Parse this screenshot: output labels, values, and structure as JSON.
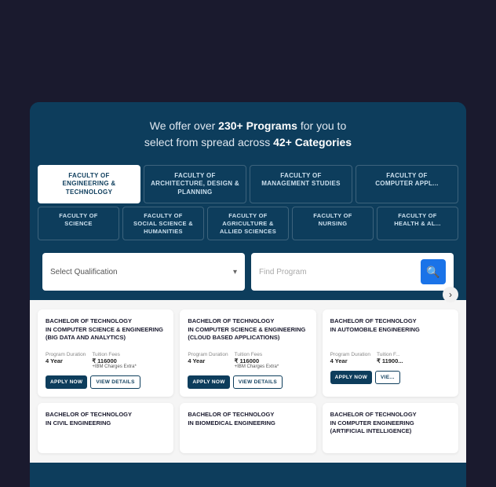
{
  "decoration": {
    "blob_color": "#f5d700"
  },
  "header": {
    "line1_prefix": "We offer over ",
    "line1_bold": "230+ Programs",
    "line1_suffix": " for you to",
    "line2_prefix": "select from spread across ",
    "line2_bold": "42+ Categories"
  },
  "tabs_row1": [
    {
      "label": "FACULTY OF\nENGINEERING & TECHNOLOGY",
      "active": true
    },
    {
      "label": "FACULTY OF\nARCHITECTURE, DESIGN & PLANNING",
      "active": false
    },
    {
      "label": "FACULTY OF\nMANAGEMENT STUDIES",
      "active": false
    },
    {
      "label": "FACULTY OF\nCOMPUTER APPL...",
      "active": false
    }
  ],
  "tabs_row2": [
    {
      "label": "FACULTY OF\nSCIENCE",
      "active": false
    },
    {
      "label": "FACULTY OF\nSOCIAL SCIENCE & HUMANITIES",
      "active": false
    },
    {
      "label": "FACULTY OF\nAGRICULTURE & ALLIED SCIENCES",
      "active": false
    },
    {
      "label": "FACULTY OF\nNURSING",
      "active": false
    },
    {
      "label": "FACULTY OF\nHEALTH & AL...",
      "active": false
    }
  ],
  "search": {
    "qualification_placeholder": "Select Qualification",
    "program_placeholder": "Find Program"
  },
  "cards": [
    {
      "title": "BACHELOR OF TECHNOLOGY\nIN COMPUTER SCIENCE & ENGINEERING\n(BIG DATA AND ANALYTICS)",
      "duration_label": "Program Duration",
      "duration_value": "4 Year",
      "fee_label": "Tuition Fees",
      "fee_value": "₹ 116000",
      "fee_extra": "+IBM Charges Extra*",
      "apply_label": "APPLY NOW",
      "view_label": "VIEW DETAILS"
    },
    {
      "title": "BACHELOR OF TECHNOLOGY\nIN COMPUTER SCIENCE & ENGINEERING\n(CLOUD BASED APPLICATIONS)",
      "duration_label": "Program Duration",
      "duration_value": "4 Year",
      "fee_label": "Tuition Fees",
      "fee_value": "₹ 116000",
      "fee_extra": "+IBM Charges Extra*",
      "apply_label": "APPLY NOW",
      "view_label": "VIEW DETAILS"
    },
    {
      "title": "BACHELOR OF TECHNOLOGY\nIN AUTOMOBILE ENGINEERING",
      "duration_label": "Program Duration",
      "duration_value": "4 Year",
      "fee_label": "Tuition F...",
      "fee_value": "₹ 11900...",
      "fee_extra": "",
      "apply_label": "APPLY NOW",
      "view_label": "VIE..."
    }
  ],
  "cards_row2": [
    {
      "title": "BACHELOR OF TECHNOLOGY\nIN CIVIL ENGINEERING",
      "partial": false
    },
    {
      "title": "BACHELOR OF TECHNOLOGY\nIN BIOMEDICAL ENGINEERING",
      "partial": false
    },
    {
      "title": "BACHELOR OF TECHNOLOGY\nIN COMPUTER ENGINEERING\n(ARTIFICIAL INTELLIGENCE)",
      "partial": true
    }
  ],
  "apply_now_label": "AppLY Now"
}
